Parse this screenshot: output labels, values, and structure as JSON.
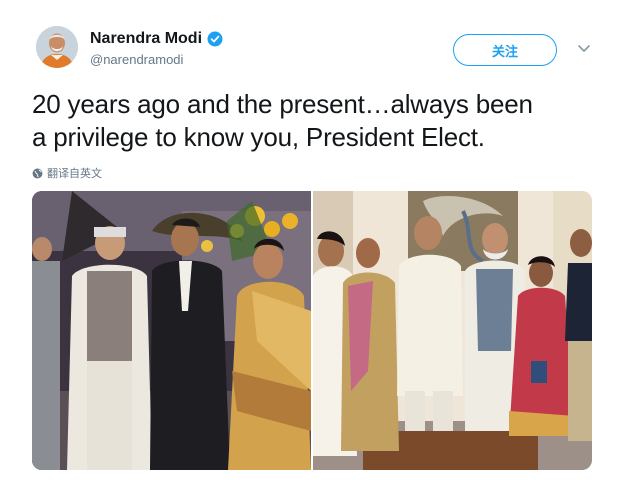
{
  "author": {
    "name": "Narendra Modi",
    "handle": "@narendramodi",
    "verified": true,
    "avatar_icon": "profile-photo"
  },
  "actions": {
    "follow_label": "关注",
    "more_icon": "chevron-down-icon"
  },
  "tweet": {
    "text_line1": "20 years ago and the present…always been",
    "text_line2": "a privilege to know you, President Elect.",
    "translate_label": "翻译自英文"
  },
  "media": {
    "photos": [
      {
        "icon": "photo-past-wedding-group"
      },
      {
        "icon": "photo-present-group"
      }
    ]
  },
  "colors": {
    "accent": "#1da1f2",
    "text": "#14171a",
    "secondary": "#657786"
  }
}
